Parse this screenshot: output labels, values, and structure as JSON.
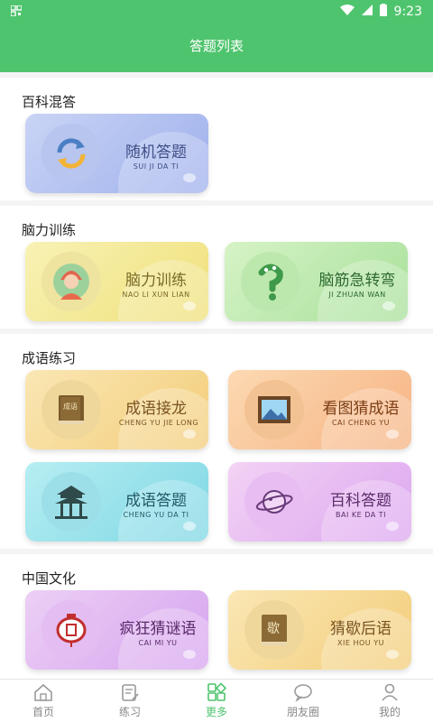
{
  "status": {
    "left_icon": "qr-icon",
    "time": "9:23"
  },
  "header": {
    "title": "答题列表"
  },
  "sections": {
    "baike": {
      "title": "百科混答",
      "cards": [
        {
          "name": "随机答题",
          "sub": "SUI JI DA TI",
          "icon": "refresh-icon"
        }
      ]
    },
    "naoli": {
      "title": "脑力训练",
      "cards": [
        {
          "name": "脑力训练",
          "sub": "NAO LI XUN LIAN",
          "icon": "person-icon"
        },
        {
          "name": "脑筋急转弯",
          "sub": "JI ZHUAN WAN",
          "icon": "question-icon"
        }
      ]
    },
    "chengyu": {
      "title": "成语练习",
      "cards": [
        {
          "name": "成语接龙",
          "sub": "CHENG YU JIE LONG",
          "icon": "book-icon",
          "book_text": "成语"
        },
        {
          "name": "看图猜成语",
          "sub": "CAI CHENG YU",
          "icon": "picture-icon"
        },
        {
          "name": "成语答题",
          "sub": "CHENG YU DA TI",
          "icon": "pavilion-icon"
        },
        {
          "name": "百科答题",
          "sub": "BAI KE DA TI",
          "icon": "planet-icon"
        }
      ]
    },
    "wenhua": {
      "title": "中国文化",
      "cards": [
        {
          "name": "疯狂猜谜语",
          "sub": "CAI MI YU",
          "icon": "lantern-icon"
        },
        {
          "name": "猜歇后语",
          "sub": "XIE HOU YU",
          "icon": "book-icon",
          "book_text": "歇"
        }
      ]
    }
  },
  "tabbar": [
    "首页",
    "练习",
    "更多",
    "朋友圈",
    "我的"
  ],
  "colors": {
    "primary": "#4fc46e"
  }
}
